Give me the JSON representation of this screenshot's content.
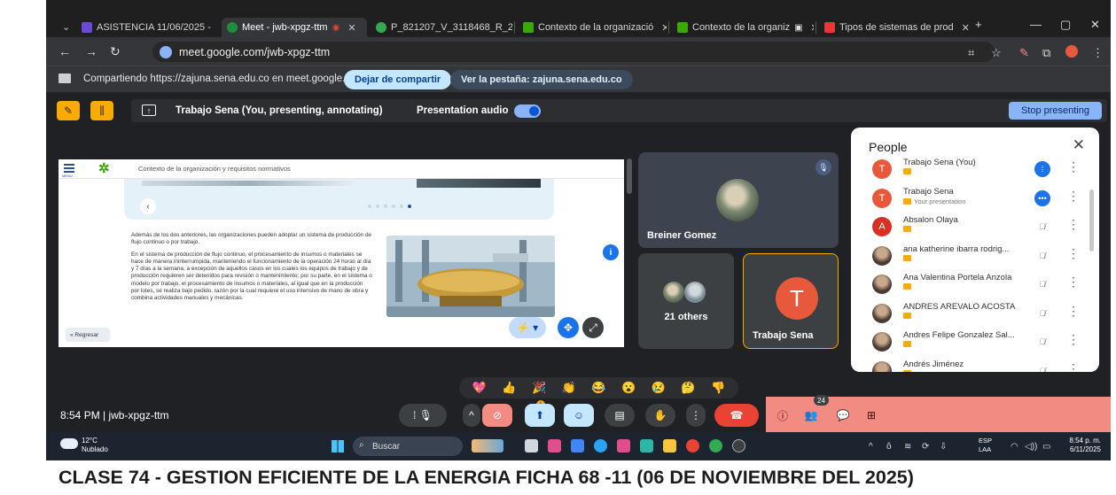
{
  "browser": {
    "tabs": [
      {
        "label": "ASISTENCIA 11/06/2025 -",
        "favicon": "#6a4bd8"
      },
      {
        "label": "Meet - jwb-xpgz-ttm",
        "favicon": "#1e8e3e"
      },
      {
        "label": "P_821207_V_3118468_R_2",
        "favicon": "#34a853"
      },
      {
        "label": "Contexto de la organizació",
        "favicon": "#39a900"
      },
      {
        "label": "Contexto de la organiz",
        "favicon": "#39a900"
      },
      {
        "label": "Tipos de sistemas de prod",
        "favicon": "#e53935"
      }
    ],
    "new_tab": "+",
    "url": "meet.google.com/jwb-xpgz-ttm"
  },
  "sharing_bar": {
    "text": "Compartiendo https://zajuna.sena.edu.co en meet.google.com",
    "stop_label": "Dejar de compartir",
    "view_label": "Ver la pestaña: zajuna.sena.edu.co"
  },
  "presenting_bar": {
    "text": "Trabajo Sena (You, presenting, annotating)",
    "audio_label": "Presentation audio",
    "stop_label": "Stop presenting"
  },
  "slide": {
    "menu_label": "MENU",
    "header_title": "Contexto de la organización y requisitos normativos",
    "para1": "Además de los dos anteriores, las organizaciones pueden adoptar un sistema de producción de flujo continuo o por trabajo.",
    "para2": "En el sistema de producción de flujo continuo, el procesamiento de insumos o materiales se hace de manera ininterrumpida, manteniendo el funcionamiento de la operación 24 horas al día y 7 días a la semana, a excepción de aquellos casos en los cuales los equipos de trabajo y de producción requieren ser detenidos para revisión o mantenimiento; por su parte, en el sistema o modelo por trabajo, el procesamiento de insumos o materiales, al igual que en la producción por lotes, se realiza bajo pedido, razón por la cual requiere el uso intensivo de mano de obra y combina actividades manuales y mecánicas.",
    "back_label": "« Regresar"
  },
  "tiles": {
    "breiner": "Breiner Gomez",
    "others": "21 others",
    "self_initial": "T",
    "self_name": "Trabajo Sena"
  },
  "people": {
    "title": "People",
    "list": [
      {
        "name": "Trabajo Sena (You)",
        "sub": "",
        "initial": "T",
        "color": "#e8593c",
        "status": "blue"
      },
      {
        "name": "Trabajo Sena",
        "sub": "Your presentation",
        "initial": "T",
        "color": "#e8593c",
        "status": "blue"
      },
      {
        "name": "Absalon Olaya",
        "sub": "",
        "initial": "A",
        "color": "#d93025",
        "status": "muted"
      },
      {
        "name": "ana katherine ibarra rodrig...",
        "sub": "",
        "initial": "",
        "color": "photo",
        "status": "muted"
      },
      {
        "name": "Ana Valentina Portela Anzola",
        "sub": "",
        "initial": "",
        "color": "photo",
        "status": "muted"
      },
      {
        "name": "ANDRES AREVALO ACOSTA",
        "sub": "",
        "initial": "",
        "color": "photo",
        "status": "muted"
      },
      {
        "name": "Andres Felipe Gonzalez Sal...",
        "sub": "",
        "initial": "",
        "color": "photo",
        "status": "muted"
      },
      {
        "name": "Andrés Jiménez",
        "sub": "",
        "initial": "",
        "color": "photo",
        "status": "muted"
      }
    ]
  },
  "reactions": [
    "💖",
    "👍",
    "🎉",
    "👏",
    "😂",
    "😮",
    "😢",
    "🤔",
    "👎"
  ],
  "controls": {
    "time_code": "8:54 PM  |  jwb-xpgz-ttm",
    "people_count": "24",
    "notif": "!"
  },
  "taskbar": {
    "temp": "12°C",
    "weather": "Nublado",
    "search": "Buscar",
    "lang1": "ESP",
    "lang2": "LAA",
    "time": "8:54 p. m.",
    "date": "6/11/2025"
  },
  "caption": "CLASE 74 - GESTION EFICIENTE DE LA ENERGIA FICHA 68 -11 (06 DE NOVIEMBRE DEL 2025)",
  "colors": {
    "meet_bg": "#202124",
    "accent": "#8ab4f8",
    "share_pink": "#f28b82",
    "hangup": "#ea4335"
  }
}
